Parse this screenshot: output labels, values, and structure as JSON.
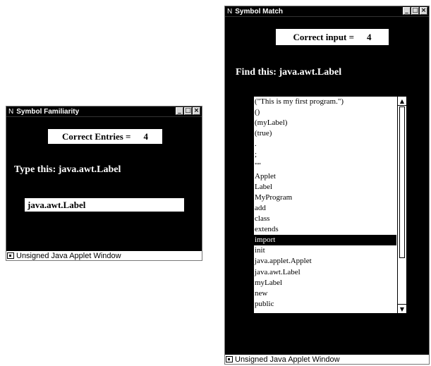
{
  "familiarity_window": {
    "title_prefix": "N",
    "title": "Symbol Familiarity",
    "buttons": {
      "minimize": "_",
      "maximize": "□",
      "close": "×"
    },
    "score_label": "Correct Entries =",
    "score_value": "4",
    "prompt": "Type this: java.awt.Label",
    "input_value": "java.awt.Label",
    "status": "Unsigned Java Applet Window"
  },
  "match_window": {
    "title_prefix": "N",
    "title": "Symbol Match",
    "buttons": {
      "minimize": "_",
      "maximize": "□",
      "close": "×"
    },
    "score_label": "Correct input =",
    "score_value": "4",
    "prompt": "Find this: java.awt.Label",
    "list_items": [
      "(\"This is my first program.\")",
      "()",
      "(myLabel)",
      "(true)",
      ".",
      ";",
      "\"\"",
      "Applet",
      "Label",
      "MyProgram",
      "add",
      "class",
      "extends",
      "import",
      "init",
      "java.applet.Applet",
      "java.awt.Label",
      "myLabel",
      "new",
      "public"
    ],
    "selected_item": "import",
    "scroll_up": "▲",
    "scroll_down": "▼",
    "status": "Unsigned Java Applet Window"
  }
}
